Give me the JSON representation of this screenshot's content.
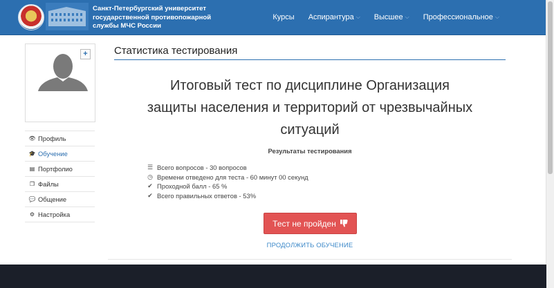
{
  "header": {
    "university_name": "Санкт-Петербургский университет государственной противопожарной службы МЧС России",
    "nav": [
      {
        "label": "Курсы",
        "has_dropdown": false
      },
      {
        "label": "Аспирантура",
        "has_dropdown": true
      },
      {
        "label": "Высшее",
        "has_dropdown": true
      },
      {
        "label": "Профессиональное",
        "has_dropdown": true
      }
    ],
    "colors": {
      "bar": "#2c6fb0"
    }
  },
  "sidebar": {
    "add_photo_label": "+",
    "items": [
      {
        "icon": "eye-icon",
        "label": "Профиль",
        "active": false
      },
      {
        "icon": "graduation-cap-icon",
        "label": "Обучение",
        "active": true
      },
      {
        "icon": "portfolio-icon",
        "label": "Портфолио",
        "active": false
      },
      {
        "icon": "files-icon",
        "label": "Файлы",
        "active": false
      },
      {
        "icon": "comments-icon",
        "label": "Общение",
        "active": false
      },
      {
        "icon": "cogs-icon",
        "label": "Настройка",
        "active": false
      }
    ]
  },
  "main": {
    "page_title": "Статистика тестирования",
    "test_name": "Итоговый тест по дисциплине Организация защиты населения и территорий от чрезвычайных ситуаций",
    "results_heading": "Результаты тестирования",
    "results": [
      {
        "icon": "list-icon",
        "text": "Всего вопросов - 30 вопросов"
      },
      {
        "icon": "clock-icon",
        "text": "Времени отведено для теста - 60 минут 00 секунд"
      },
      {
        "icon": "check-icon",
        "text": "Проходной балл - 65 %"
      },
      {
        "icon": "check-icon",
        "text": "Всего правильных ответов - 53%"
      }
    ],
    "fail_button": "Тест не пройден",
    "continue_link": "ПРОДОЛЖИТЬ ОБУЧЕНИЕ",
    "colors": {
      "fail": "#e25353",
      "link": "#3a87c8",
      "footer": "#1b1f29"
    }
  }
}
